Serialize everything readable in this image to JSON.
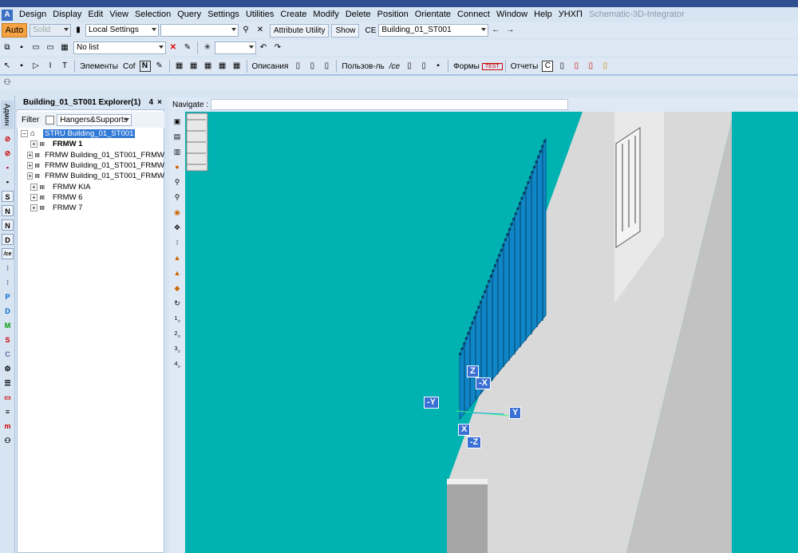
{
  "menu": {
    "items": [
      "Design",
      "Display",
      "Edit",
      "View",
      "Selection",
      "Query",
      "Settings",
      "Utilities",
      "Create",
      "Modify",
      "Delete",
      "Position",
      "Orientate",
      "Connect",
      "Window",
      "Help",
      "УНХП"
    ],
    "app_title": "Schematic-3D-Integrator"
  },
  "toolbar1": {
    "auto_label": "Auto",
    "solid_label": "Solid",
    "settings_value": "Local Settings",
    "attribute_utility": "Attribute Utility",
    "show_label": "Show",
    "ce_label": "CE",
    "ce_value": "Building_01_ST001"
  },
  "toolbar2": {
    "list_value": "No list"
  },
  "toolbar3": {
    "elements": "Элементы",
    "cof": "Cof",
    "descriptions": "Описания",
    "user": "Пользов-ль",
    "ice": "/ce",
    "forms": "Формы",
    "test": "TEST",
    "reports": "Отчеты",
    "c_label": "C"
  },
  "leftbar": {
    "vtab_label": "Админ",
    "icons": [
      "S",
      "N",
      "N",
      "D",
      "/ce",
      "P",
      "D",
      "M",
      "S",
      "C"
    ]
  },
  "explorer": {
    "title": "Building_01_ST001 Explorer(1)",
    "pin": "4",
    "close": "×",
    "filter_label": "Filter",
    "filter_value": "Hangers&Supports",
    "tree": [
      {
        "label": "STRU Building_01_ST001",
        "selected": true,
        "level": 0
      },
      {
        "label": "FRMW 1",
        "bold": true,
        "level": 1
      },
      {
        "label": "FRMW Building_01_ST001_FRMW",
        "level": 1
      },
      {
        "label": "FRMW Building_01_ST001_FRMW",
        "level": 1
      },
      {
        "label": "FRMW Building_01_ST001_FRMW",
        "level": 1
      },
      {
        "label": "FRMW KIA",
        "level": 1
      },
      {
        "label": "FRMW 6",
        "level": 1
      },
      {
        "label": "FRMW 7",
        "level": 1
      }
    ]
  },
  "navigate": {
    "label": "Navigate :"
  },
  "viewport": {
    "background": "#00b2b2",
    "axes": {
      "z": "Z",
      "neg_x": "-X",
      "neg_y": "-Y",
      "y": "Y",
      "x": "X",
      "neg_z": "-Z"
    },
    "viewbar_labels": [
      "1",
      "2",
      "3",
      "4"
    ]
  }
}
